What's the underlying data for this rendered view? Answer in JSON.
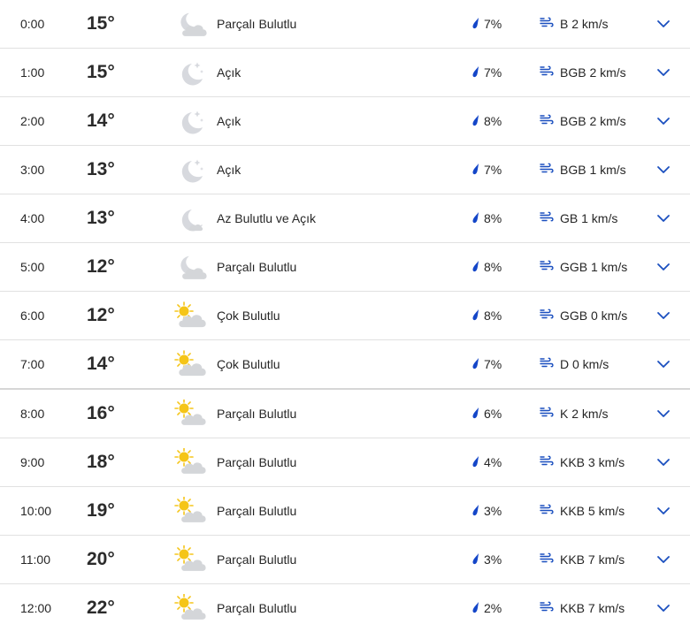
{
  "rows": [
    {
      "time": "0:00",
      "temp": "15°",
      "desc": "Parçalı Bulutlu",
      "rain": "7%",
      "wind": "B 2 km/s",
      "icon": "night-partly-cloudy-icon"
    },
    {
      "time": "1:00",
      "temp": "15°",
      "desc": "Açık",
      "rain": "7%",
      "wind": "BGB 2 km/s",
      "icon": "night-clear-icon"
    },
    {
      "time": "2:00",
      "temp": "14°",
      "desc": "Açık",
      "rain": "8%",
      "wind": "BGB 2 km/s",
      "icon": "night-clear-icon"
    },
    {
      "time": "3:00",
      "temp": "13°",
      "desc": "Açık",
      "rain": "7%",
      "wind": "BGB 1 km/s",
      "icon": "night-clear-icon"
    },
    {
      "time": "4:00",
      "temp": "13°",
      "desc": "Az Bulutlu ve Açık",
      "rain": "8%",
      "wind": "GB 1 km/s",
      "icon": "night-mostly-clear-icon"
    },
    {
      "time": "5:00",
      "temp": "12°",
      "desc": "Parçalı Bulutlu",
      "rain": "8%",
      "wind": "GGB 1 km/s",
      "icon": "night-partly-cloudy-icon"
    },
    {
      "time": "6:00",
      "temp": "12°",
      "desc": "Çok Bulutlu",
      "rain": "8%",
      "wind": "GGB 0 km/s",
      "icon": "day-mostly-cloudy-icon"
    },
    {
      "time": "7:00",
      "temp": "14°",
      "desc": "Çok Bulutlu",
      "rain": "7%",
      "wind": "D 0 km/s",
      "icon": "day-mostly-cloudy-icon"
    },
    {
      "time": "8:00",
      "temp": "16°",
      "desc": "Parçalı Bulutlu",
      "rain": "6%",
      "wind": "K 2 km/s",
      "icon": "day-partly-cloudy-icon"
    },
    {
      "time": "9:00",
      "temp": "18°",
      "desc": "Parçalı Bulutlu",
      "rain": "4%",
      "wind": "KKB 3 km/s",
      "icon": "day-partly-cloudy-icon"
    },
    {
      "time": "10:00",
      "temp": "19°",
      "desc": "Parçalı Bulutlu",
      "rain": "3%",
      "wind": "KKB 5 km/s",
      "icon": "day-partly-cloudy-icon"
    },
    {
      "time": "11:00",
      "temp": "20°",
      "desc": "Parçalı Bulutlu",
      "rain": "3%",
      "wind": "KKB 7 km/s",
      "icon": "day-partly-cloudy-icon"
    },
    {
      "time": "12:00",
      "temp": "22°",
      "desc": "Parçalı Bulutlu",
      "rain": "2%",
      "wind": "KKB 7 km/s",
      "icon": "day-partly-cloudy-icon"
    }
  ],
  "colors": {
    "accent": "#1a4fbf",
    "rain_drop": "#1446c8",
    "wind_icon": "#1a4fbf",
    "moon": "#d7d9de",
    "cloud": "#d4d6d9",
    "sun": "#f5c518",
    "divider": "#e1e1e1"
  }
}
